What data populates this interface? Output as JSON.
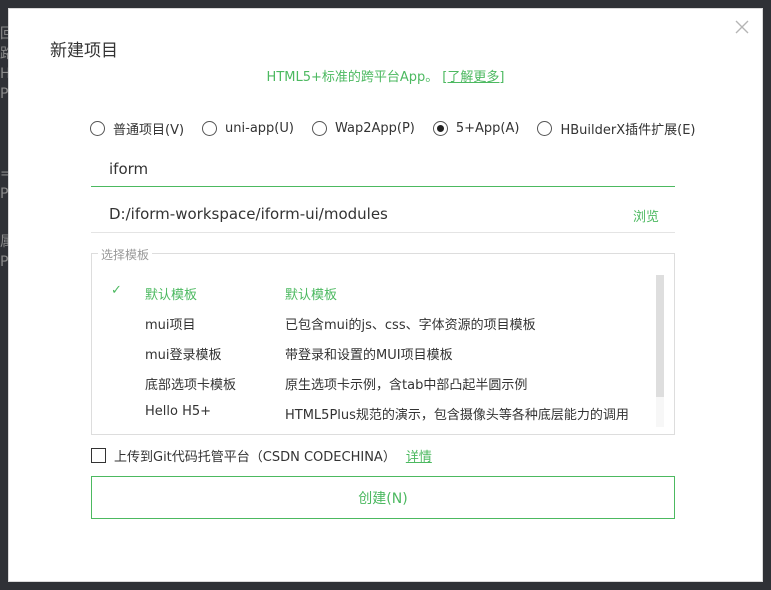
{
  "background": {
    "fragments": [
      "回调",
      "路由",
      "HE",
      "PP",
      "==",
      "PP",
      "属",
      "PP"
    ]
  },
  "dialog": {
    "title": "新建项目",
    "subtitle": "HTML5+标准的跨平台App。",
    "subtitle_link": "[了解更多]",
    "accent_color": "#4cb960"
  },
  "project_types": [
    {
      "label": "普通项目(V)",
      "checked": false
    },
    {
      "label": "uni-app(U)",
      "checked": false
    },
    {
      "label": "Wap2App(P)",
      "checked": false
    },
    {
      "label": "5+App(A)",
      "checked": true
    },
    {
      "label": "HBuilderX插件扩展(E)",
      "checked": false
    }
  ],
  "project_name": {
    "value": "iform"
  },
  "project_path": {
    "value": "D:/iform-workspace/iform-ui/modules",
    "browse_label": "浏览"
  },
  "templates": {
    "legend": "选择模板",
    "check_mark": "✓",
    "items": [
      {
        "name": "默认模板",
        "desc": "默认模板"
      },
      {
        "name": "mui项目",
        "desc": "已包含mui的js、css、字体资源的项目模板"
      },
      {
        "name": "mui登录模板",
        "desc": "带登录和设置的MUI项目模板"
      },
      {
        "name": "底部选项卡模板",
        "desc": "原生选项卡示例，含tab中部凸起半圆示例"
      },
      {
        "name": "Hello H5+",
        "desc": "HTML5Plus规范的演示，包含摄像头等各种底层能力的调用"
      }
    ]
  },
  "git": {
    "label": "上传到Git代码托管平台（CSDN CODECHINA）",
    "detail_link": "详情",
    "checked": false
  },
  "create_button": {
    "label": "创建(N)"
  }
}
